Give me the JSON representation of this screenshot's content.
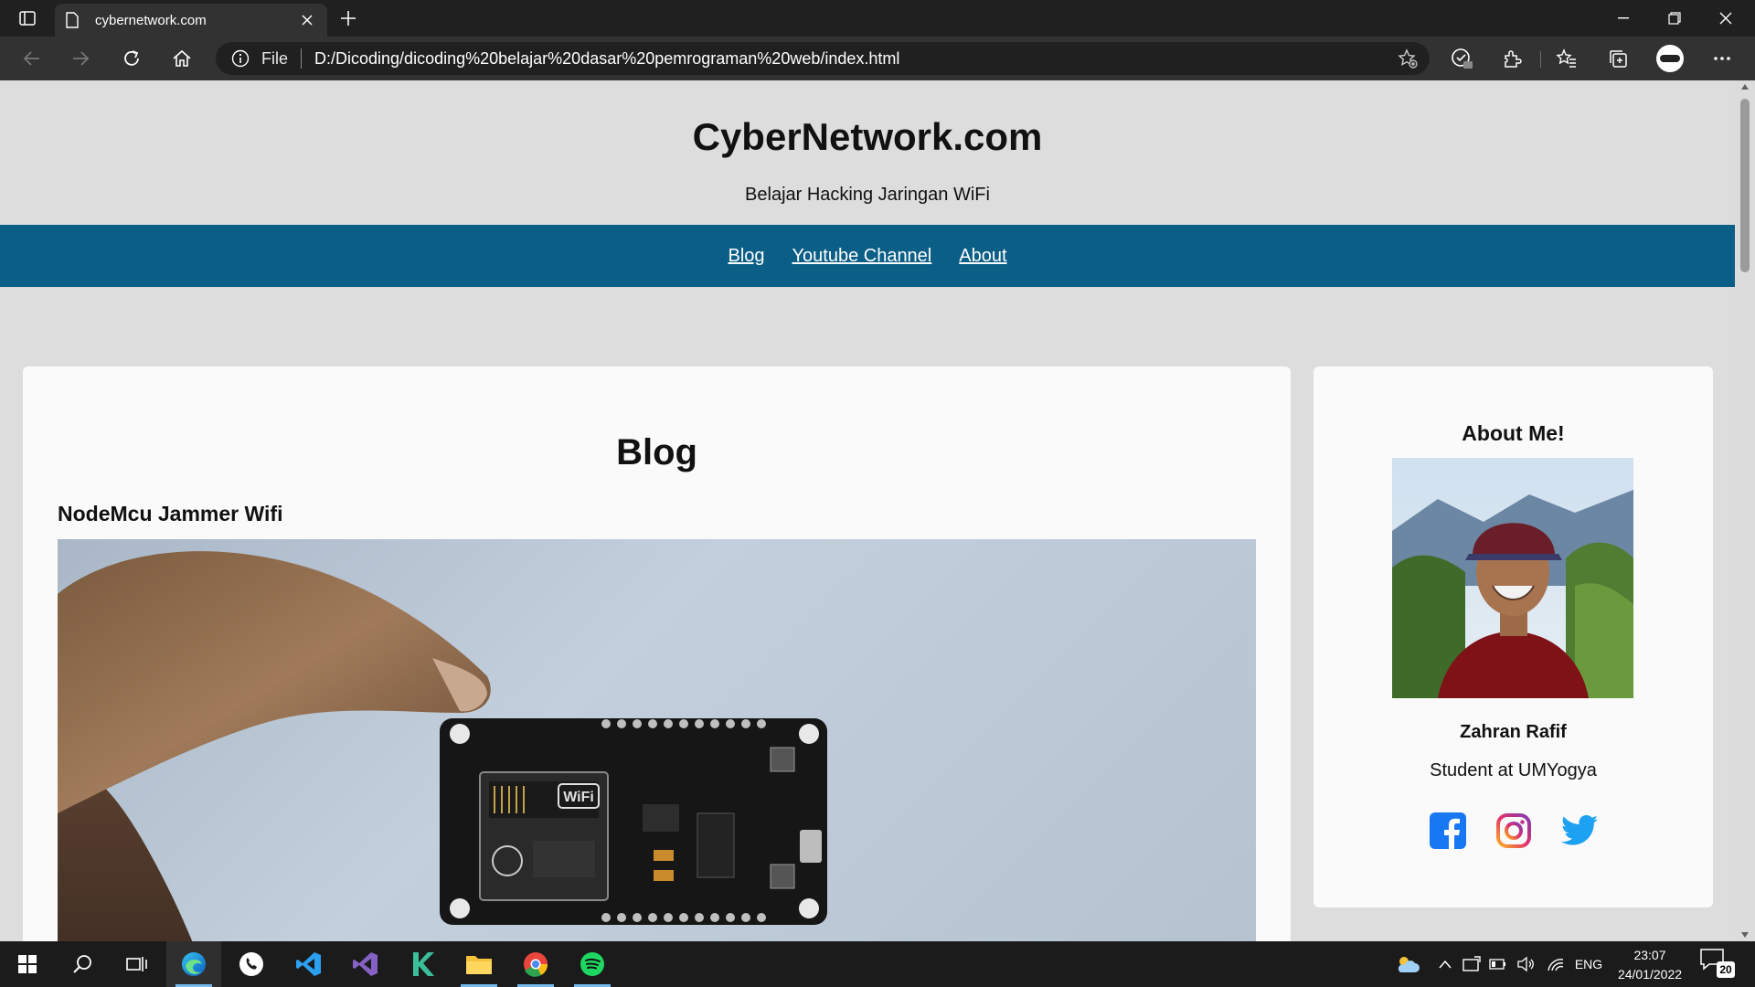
{
  "browser": {
    "tab_title": "cybernetwork.com",
    "address_prefix": "File",
    "url": "D:/Dicoding/dicoding%20belajar%20dasar%20pemrograman%20web/index.html"
  },
  "site": {
    "title": "CyberNetwork.com",
    "tagline": "Belajar Hacking Jaringan WiFi",
    "nav": [
      "Blog",
      "Youtube Channel",
      "About"
    ]
  },
  "main": {
    "heading": "Blog",
    "post_title": "NodeMcu Jammer Wifi",
    "board_label": "WiFi"
  },
  "sidebar": {
    "heading": "About Me!",
    "name": "Zahran Rafif",
    "role": "Student at UMYogya",
    "social": [
      "facebook-icon",
      "instagram-icon",
      "twitter-icon"
    ]
  },
  "taskbar": {
    "language": "ENG",
    "time": "23:07",
    "date": "24/01/2022",
    "notification_count": "20"
  },
  "colors": {
    "nav_bg": "#0b5e86",
    "page_bg": "#dddddd",
    "card_bg": "#fafafa",
    "facebook": "#1877f2",
    "twitter": "#1da1f2"
  }
}
